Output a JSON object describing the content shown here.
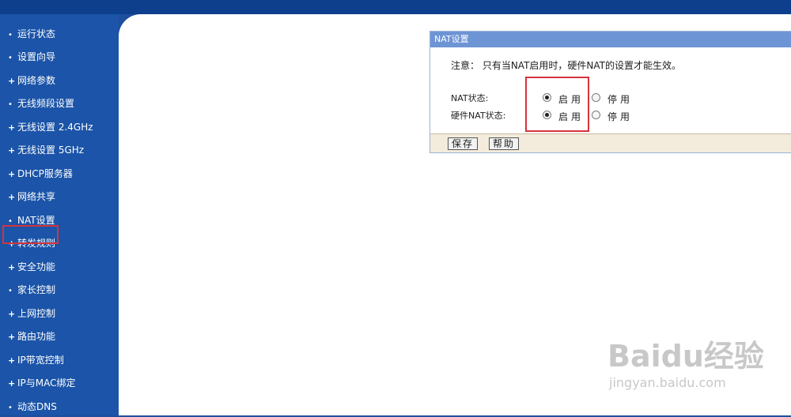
{
  "sidebar": {
    "items": [
      {
        "label": "运行状态",
        "marker": "•"
      },
      {
        "label": "设置向导",
        "marker": "•"
      },
      {
        "label": "网络参数",
        "marker": "+"
      },
      {
        "label": "无线频段设置",
        "marker": "•"
      },
      {
        "label": "无线设置 2.4GHz",
        "marker": "+"
      },
      {
        "label": "无线设置 5GHz",
        "marker": "+"
      },
      {
        "label": "DHCP服务器",
        "marker": "+"
      },
      {
        "label": "网络共享",
        "marker": "+"
      },
      {
        "label": "NAT设置",
        "marker": "•"
      },
      {
        "label": "转发规则",
        "marker": "+"
      },
      {
        "label": "安全功能",
        "marker": "+"
      },
      {
        "label": "家长控制",
        "marker": "•"
      },
      {
        "label": "上网控制",
        "marker": "+"
      },
      {
        "label": "路由功能",
        "marker": "+"
      },
      {
        "label": "IP带宽控制",
        "marker": "+"
      },
      {
        "label": "IP与MAC绑定",
        "marker": "+"
      },
      {
        "label": "动态DNS",
        "marker": "•"
      }
    ]
  },
  "panel": {
    "title": "NAT设置",
    "notice": "注意： 只有当NAT启用时，硬件NAT的设置才能生效。",
    "nat_status": {
      "label": "NAT状态:",
      "enable_label": "启用",
      "disable_label": "停用",
      "selected": "enable"
    },
    "hw_nat_status": {
      "label": "硬件NAT状态:",
      "enable_label": "启用",
      "disable_label": "停用",
      "selected": "enable"
    },
    "save_label": "保存",
    "help_label": "帮助"
  },
  "watermark": {
    "main": "Baidu经验",
    "sub": "jingyan.baidu.com"
  },
  "colors": {
    "sidebar_bg": "#1b54a8",
    "panel_header": "#6d94d5",
    "highlight": "#d4343b",
    "footer_bg": "#f3ebdc"
  }
}
